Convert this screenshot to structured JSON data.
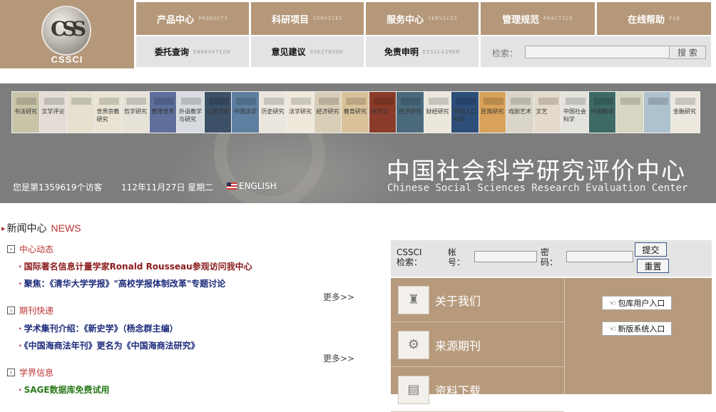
{
  "logo": {
    "brand": "CSSCI",
    "mark": "CSS"
  },
  "nav_top": [
    {
      "cn": "产品中心",
      "en": "PRODUCTS"
    },
    {
      "cn": "科研项目",
      "en": "SERVICES"
    },
    {
      "cn": "服务中心",
      "en": "SERVICES"
    },
    {
      "cn": "管理规范",
      "en": "PRACTICE"
    },
    {
      "cn": "在线帮助",
      "en": "FAQ"
    }
  ],
  "nav_bottom": [
    {
      "cn": "委托查询",
      "en": "INNOVATION"
    },
    {
      "cn": "意见建议",
      "en": "GUESTBOOK"
    },
    {
      "cn": "免责申明",
      "en": "DISCLAIMER"
    }
  ],
  "search": {
    "label": "检索：",
    "button": "搜 索",
    "value": ""
  },
  "banner": {
    "title": "中国社会科学研究评价中心",
    "subtitle": "Chinese Social Sciences Research Evaluation Center",
    "visitor": "您是第1359619个访客",
    "date": "112年11月27日 星期二",
    "english": "ENGLISH",
    "covers": [
      {
        "text": "书法研究",
        "color": "#c8c4a8"
      },
      {
        "text": "文学评论",
        "color": "#e4ddd6"
      },
      {
        "text": "",
        "color": "#e6e1cf"
      },
      {
        "text": "世界宗教研究",
        "color": "#e8e3d2"
      },
      {
        "text": "哲学研究",
        "color": "#e7e2d8"
      },
      {
        "text": "管理世界",
        "color": "#5d6f9a"
      },
      {
        "text": "外语教学与研究",
        "color": "#d8dbe0"
      },
      {
        "text": "心理学报",
        "color": "#3c5068"
      },
      {
        "text": "中国法学",
        "color": "#5d7fa0"
      },
      {
        "text": "历史研究",
        "color": "#eae6dd"
      },
      {
        "text": "法学研究",
        "color": "#efe9db"
      },
      {
        "text": "经济研究",
        "color": "#d8cdb6"
      },
      {
        "text": "教育研究",
        "color": "#d9c29a"
      },
      {
        "text": "经济学",
        "color": "#8a3b2a"
      },
      {
        "text": "经济研究",
        "color": "#4a6a7c"
      },
      {
        "text": "财经研究",
        "color": "#ece7dc"
      },
      {
        "text": "中国人口科学",
        "color": "#2d4e78"
      },
      {
        "text": "民族研究",
        "color": "#d9a25a"
      },
      {
        "text": "戏剧艺术",
        "color": "#d9d5c9"
      },
      {
        "text": "文艺",
        "color": "#e4dacb"
      },
      {
        "text": "中国社会科学",
        "color": "#e4e2dc"
      },
      {
        "text": "中国翻译",
        "color": "#3e6a66"
      },
      {
        "text": "",
        "color": "#d7d6c2"
      },
      {
        "text": "",
        "color": "#aec1cf"
      },
      {
        "text": "金融研究",
        "color": "#ece8de"
      }
    ]
  },
  "news": {
    "title": "新闻中心",
    "title_en": "NEWS",
    "more": "更多>>",
    "sections": [
      {
        "title": "中心动态",
        "items": [
          {
            "text": "国际著名信息计量学家Ronald Rousseau参观访问我中心",
            "color": "red"
          },
          {
            "text": "聚焦：《清华大学学报》\"高校学报体制改革\"专题讨论",
            "color": "blue"
          }
        ]
      },
      {
        "title": "期刊快递",
        "items": [
          {
            "text": "学术集刊介绍：《新史学》（杨念群主编）",
            "color": "blue"
          },
          {
            "text": "《中国海商法年刊》更名为《中国海商法研究》",
            "color": "blue"
          }
        ]
      },
      {
        "title": "学界信息",
        "items": [
          {
            "text": "SAGE数据库免费试用",
            "color": "green"
          }
        ]
      }
    ]
  },
  "login": {
    "title": "CSSCI检索：",
    "account": "帐号：",
    "password": "密码：",
    "submit": "提交",
    "reset": "重置"
  },
  "menu": [
    {
      "label": "关于我们",
      "icon": "tie-icon"
    },
    {
      "label": "来源期刊",
      "icon": "film-icon"
    },
    {
      "label": "资料下载",
      "icon": "document-icon"
    }
  ],
  "entries": [
    {
      "label": "包库用户入口"
    },
    {
      "label": "新版系统入口"
    }
  ]
}
